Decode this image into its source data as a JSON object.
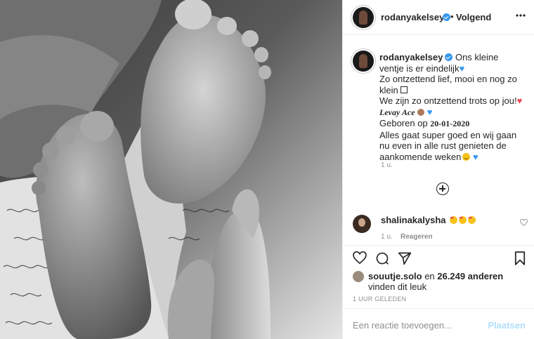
{
  "post": {
    "username": "rodanyakelsey",
    "dot": "•",
    "follow_label": "Volgend",
    "more_icon": "more-horizontal-icon",
    "caption": {
      "line1": "Ons kleine ventje is er eindelijk",
      "line2": "Zo ontzettend lief, mooi en nog zo klein",
      "line3": "We zijn zo ontzettend trots op jou!",
      "name": "Levay Ace",
      "born_prefix": "Geboren op",
      "born_date": "20-01-2020",
      "line5": "Alles gaat super goed en wij gaan nu even in alle rust genieten de aankomende weken"
    },
    "caption_time": "1 u.",
    "comments": [
      {
        "username": "shalinakalysha",
        "time": "1 u.",
        "reply_label": "Reageren"
      }
    ],
    "likes": {
      "liker": "souutje.solo",
      "joiner": "en",
      "count": "26.249 anderen",
      "suffix": "vinden dit leuk"
    },
    "timestamp": "1 UUR GELEDEN",
    "comment_placeholder": "Een reactie toevoegen...",
    "post_label": "Plaatsen"
  },
  "colors": {
    "verified": "#3897f0",
    "muted": "#8e8e8e",
    "post_button_disabled": "#b2dffc"
  }
}
